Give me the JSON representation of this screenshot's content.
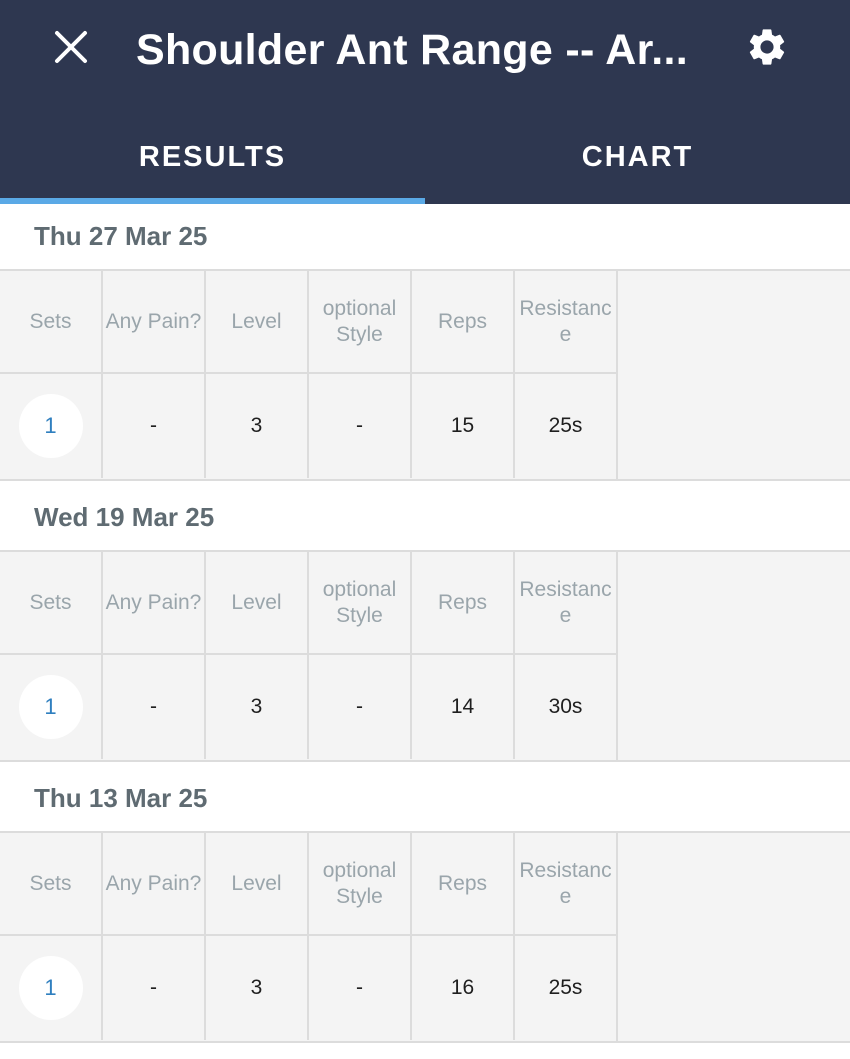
{
  "header": {
    "title": "Shoulder Ant Range -- Ar...",
    "close_icon": "close-icon",
    "settings_icon": "gear-icon",
    "background_color": "#2e3750",
    "accent_color": "#5aa9e6"
  },
  "tabs": [
    {
      "label": "RESULTS",
      "active": true
    },
    {
      "label": "CHART",
      "active": false
    }
  ],
  "columns": [
    "Sets",
    "Any Pain?",
    "Level",
    "optional Style",
    "Reps",
    "Resistance"
  ],
  "sessions": [
    {
      "date": "Thu 27 Mar 25",
      "row": {
        "set": "1",
        "pain": "-",
        "level": "3",
        "style": "-",
        "reps": "15",
        "resistance": "25s"
      }
    },
    {
      "date": "Wed 19 Mar 25",
      "row": {
        "set": "1",
        "pain": "-",
        "level": "3",
        "style": "-",
        "reps": "14",
        "resistance": "30s"
      }
    },
    {
      "date": "Thu 13 Mar 25",
      "row": {
        "set": "1",
        "pain": "-",
        "level": "3",
        "style": "-",
        "reps": "16",
        "resistance": "25s"
      }
    }
  ]
}
